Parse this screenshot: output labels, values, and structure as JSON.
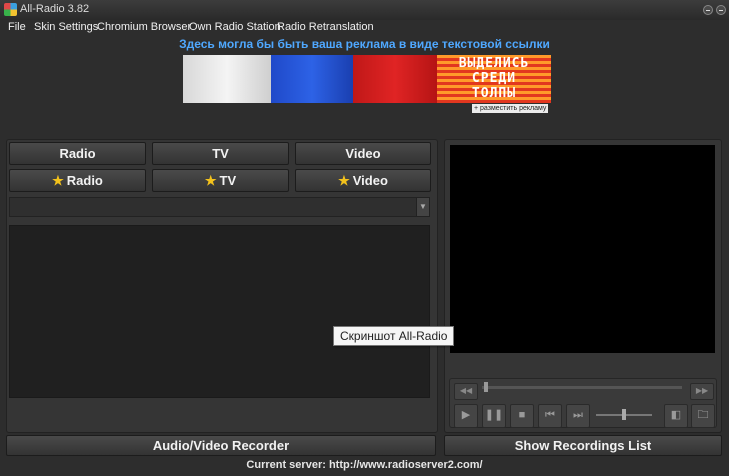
{
  "window": {
    "title": "All-Radio 3.82"
  },
  "menu": [
    "File",
    "Skin Settings",
    "Chromium Browser",
    "Own Radio Station",
    "Radio Retranslation"
  ],
  "ad": {
    "text": "Здесь могла бы быть ваша реклама в виде текстовой ссылки",
    "banner_lines": [
      "ВЫДЕЛИСЬ",
      "СРЕДИ",
      "ТОЛПЫ"
    ],
    "link": "+ разместить рекламу"
  },
  "tabs_row1": [
    "Radio",
    "TV",
    "Video"
  ],
  "tabs_row2": [
    "Radio",
    "TV",
    "Video"
  ],
  "tooltip": "Скриншот All-Radio",
  "buttons": {
    "recorder": "Audio/Video Recorder",
    "recordings": "Show Recordings List"
  },
  "status": {
    "server": "Current server: http://www.radioserver2.com/"
  },
  "colors": {
    "accent": "#4fa8ff",
    "star": "#f3c21c",
    "background": "#2d2d2d"
  }
}
